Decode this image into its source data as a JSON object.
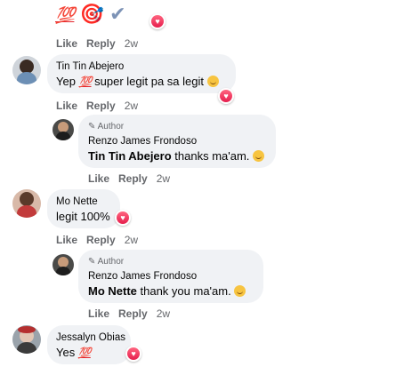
{
  "top": {
    "emoji_hundred": "💯",
    "emoji_target": "🎯",
    "emoji_check": "✔",
    "actions": {
      "like": "Like",
      "reply": "Reply",
      "time": "2w"
    }
  },
  "comments": [
    {
      "name": "Tin Tin Abejero",
      "text_a": "Yep ",
      "emoji": "💯",
      "text_b": " super legit pa sa legit ",
      "actions": {
        "like": "Like",
        "reply": "Reply",
        "time": "2w"
      },
      "reply": {
        "author_label": "Author",
        "name": "Renzo James Frondoso",
        "mention": "Tin Tin Abejero",
        "text": " thanks ma'am. ",
        "actions": {
          "like": "Like",
          "reply": "Reply",
          "time": "2w"
        }
      }
    },
    {
      "name": "Mo Nette",
      "text": "legit 100%",
      "actions": {
        "like": "Like",
        "reply": "Reply",
        "time": "2w"
      },
      "reply": {
        "author_label": "Author",
        "name": "Renzo James Frondoso",
        "mention": "Mo Nette",
        "text": " thank you ma'am. ",
        "actions": {
          "like": "Like",
          "reply": "Reply",
          "time": "2w"
        }
      }
    },
    {
      "name": "Jessalyn Obias",
      "text": "Yes ",
      "emoji": "💯"
    }
  ],
  "colors": {
    "bubble": "#f0f2f5",
    "meta": "#65676b",
    "heart": "#e61e4d"
  },
  "icons": {
    "reaction": "love-reaction-icon",
    "author": "pencil-icon"
  }
}
